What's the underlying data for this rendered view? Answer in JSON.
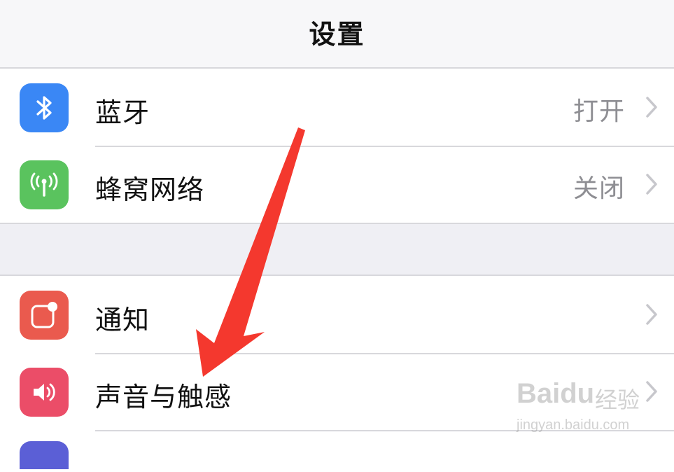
{
  "navbar": {
    "title": "设置"
  },
  "groups": [
    {
      "rows": [
        {
          "label": "蓝牙",
          "value": "打开",
          "icon": "bluetooth-icon",
          "icon_color": "#3a87f5"
        },
        {
          "label": "蜂窝网络",
          "value": "关闭",
          "icon": "cellular-antenna-icon",
          "icon_color": "#5ac35e"
        }
      ]
    },
    {
      "rows": [
        {
          "label": "通知",
          "value": "",
          "icon": "notifications-icon",
          "icon_color": "#ea5a4e"
        },
        {
          "label": "声音与触感",
          "value": "",
          "icon": "speaker-icon",
          "icon_color": "#eb4d68"
        }
      ]
    }
  ],
  "watermark": {
    "logo": "Baidu",
    "cn": "经验",
    "url": "jingyan.baidu.com"
  },
  "annotation": {
    "arrow_color": "#f4382e",
    "points_to": "声音与触感"
  }
}
